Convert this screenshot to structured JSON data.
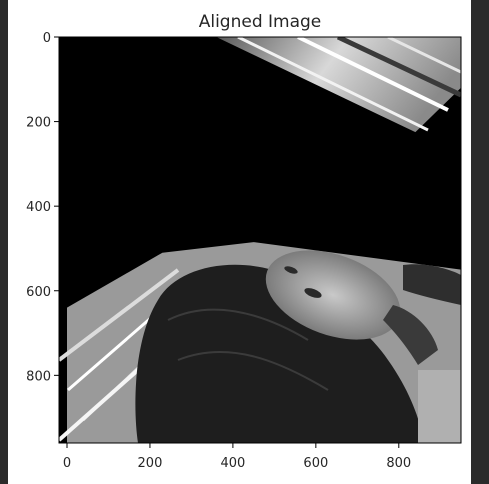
{
  "chart_data": {
    "type": "image",
    "title": "Aligned Image",
    "colormap": "gray",
    "xlim": [
      0,
      950
    ],
    "ylim": [
      960,
      0
    ],
    "xticks": [
      0,
      200,
      400,
      600,
      800
    ],
    "yticks": [
      0,
      200,
      400,
      600,
      800
    ],
    "xtick_labels": [
      "0",
      "200",
      "400",
      "600",
      "800"
    ],
    "ytick_labels": [
      "0",
      "200",
      "400",
      "600",
      "800"
    ],
    "content_description": "Rotated, perspective-warped grayscale photo of a person's face with dark hair, black empty regions outside the warped image area",
    "warp_regions": {
      "top_patch": [
        [
          360,
          0
        ],
        [
          950,
          0
        ],
        [
          950,
          120
        ],
        [
          840,
          225
        ]
      ],
      "bottom_patch": [
        [
          0,
          640
        ],
        [
          230,
          510
        ],
        [
          450,
          485
        ],
        [
          950,
          550
        ],
        [
          950,
          960
        ],
        [
          0,
          960
        ]
      ]
    }
  },
  "colors": {
    "window_background": "#2b2b2b",
    "figure_background": "#ffffff",
    "empty_region": "#000000"
  }
}
